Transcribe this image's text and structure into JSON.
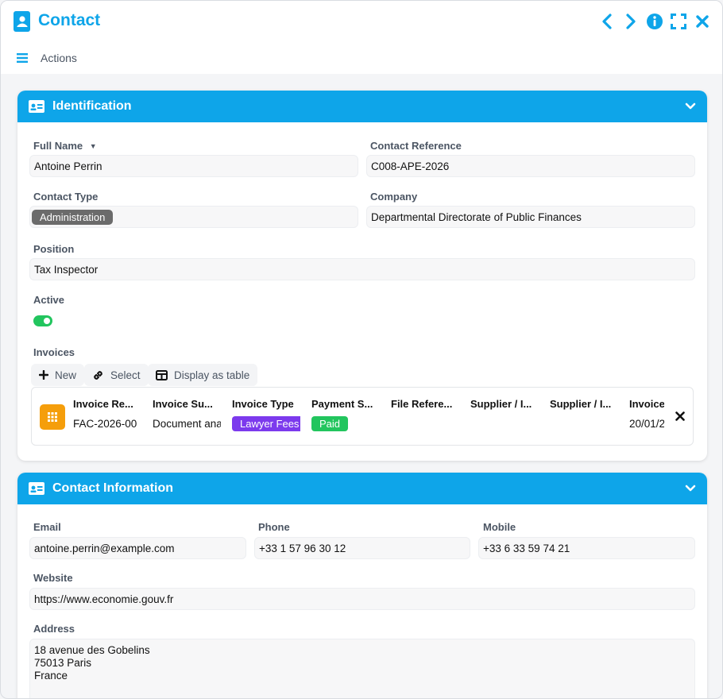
{
  "window": {
    "title": "Contact"
  },
  "toolbar": {
    "actions_label": "Actions"
  },
  "colors": {
    "accent": "#0ea5e9",
    "admin_tag": "#6b6b6b",
    "lawyer_fees": "#7c3aed",
    "paid": "#22c55e",
    "grid_icon": "#f59e0b"
  },
  "identification": {
    "title": "Identification",
    "full_name_label": "Full Name",
    "full_name": "Antoine Perrin",
    "contact_ref_label": "Contact Reference",
    "contact_ref": "C008-APE-2026",
    "contact_type_label": "Contact Type",
    "contact_type": "Administration",
    "company_label": "Company",
    "company": "Departmental Directorate of Public Finances",
    "position_label": "Position",
    "position": "Tax Inspector",
    "active_label": "Active",
    "active": true,
    "invoices_label": "Invoices",
    "invoices_buttons": {
      "new": "New",
      "select": "Select",
      "table": "Display as table"
    },
    "invoice_columns": [
      "Invoice Re...",
      "Invoice Su...",
      "Invoice Type",
      "Payment S...",
      "File Refere...",
      "Supplier / I...",
      "Supplier / I...",
      "Invoice"
    ],
    "invoice_row": {
      "ref": "FAC-2026-00",
      "subject": "Document ana",
      "type": "Lawyer Fees",
      "payment": "Paid",
      "file_ref": "",
      "supplier1": "",
      "supplier2": "",
      "date": "20/01/2"
    }
  },
  "contact_info": {
    "title": "Contact Information",
    "email_label": "Email",
    "email": "antoine.perrin@example.com",
    "phone_label": "Phone",
    "phone": "+33 1 57 96 30 12",
    "mobile_label": "Mobile",
    "mobile": "+33 6 33 59 74 21",
    "website_label": "Website",
    "website": "https://www.economie.gouv.fr",
    "address_label": "Address",
    "address": "18 avenue des Gobelins\n75013 Paris\nFrance"
  }
}
